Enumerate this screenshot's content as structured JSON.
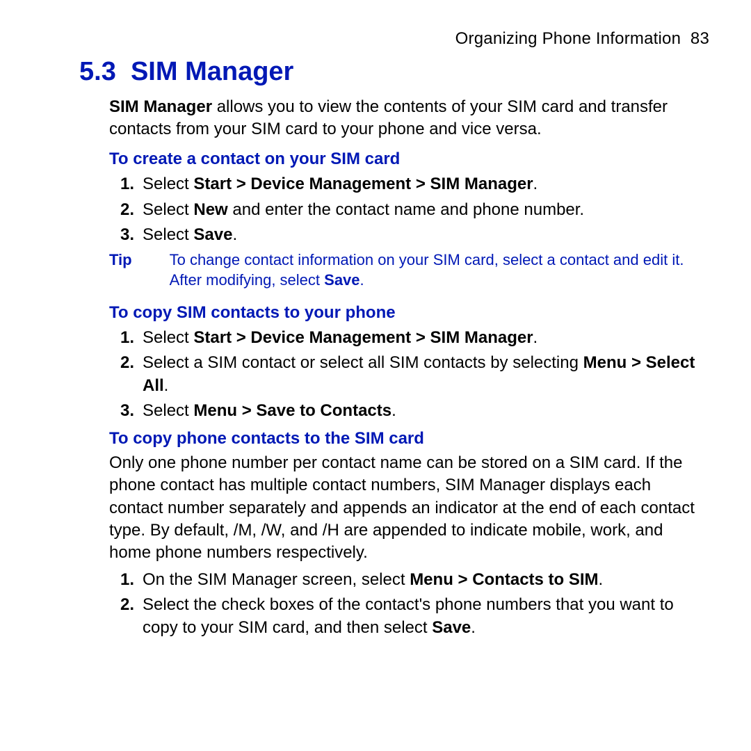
{
  "header": {
    "chapter": "Organizing Phone Information",
    "page_number": "83"
  },
  "section": {
    "number": "5.3",
    "title": "SIM Manager"
  },
  "intro": {
    "lead_bold": "SIM Manager",
    "rest": " allows you to view the contents of your SIM card and transfer contacts from your SIM card to your phone and vice versa."
  },
  "sub1": {
    "heading": "To create a contact on your SIM card",
    "steps": {
      "s1_a": "Select ",
      "s1_b": "Start > Device Management > SIM Manager",
      "s1_c": ".",
      "s2_a": "Select ",
      "s2_b": "New",
      "s2_c": " and enter the contact name and phone number.",
      "s3_a": "Select ",
      "s3_b": "Save",
      "s3_c": "."
    },
    "tip": {
      "label": "Tip",
      "text_a": "To change contact information on your SIM card, select a contact and edit it. After modifying, select ",
      "text_b": "Save",
      "text_c": "."
    }
  },
  "sub2": {
    "heading": "To copy SIM contacts to your phone",
    "steps": {
      "s1_a": "Select ",
      "s1_b": "Start > Device Management > SIM Manager",
      "s1_c": ".",
      "s2_a": "Select a SIM contact or select all SIM contacts by selecting ",
      "s2_b": "Menu > Select All",
      "s2_c": ".",
      "s3_a": "Select ",
      "s3_b": "Menu > Save to Contacts",
      "s3_c": "."
    }
  },
  "sub3": {
    "heading": "To copy phone contacts to the SIM card",
    "para": "Only one phone number per contact name can be stored on a SIM card. If the phone contact has multiple contact numbers, SIM Manager displays each contact number separately and appends an indicator at the end of each contact type. By default, /M, /W, and /H are appended to indicate mobile, work, and home phone numbers respectively.",
    "steps": {
      "s1_a": "On the SIM Manager screen, select ",
      "s1_b": "Menu > Contacts to SIM",
      "s1_c": ".",
      "s2_a": "Select the check boxes of the contact's phone numbers that you want to copy to your SIM card, and then select ",
      "s2_b": "Save",
      "s2_c": "."
    }
  }
}
